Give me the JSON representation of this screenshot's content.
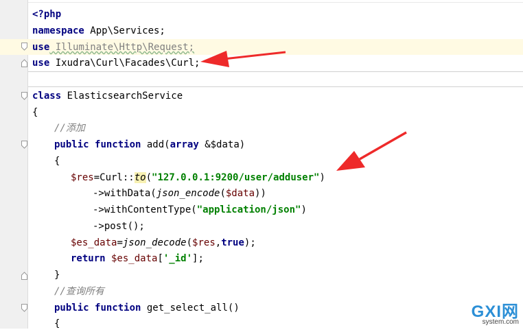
{
  "code": {
    "l1_tag": "<?php",
    "l2_kw": "namespace",
    "l2_rest": " App\\Services;",
    "l3_kw": "use",
    "l3_rest": " Illuminate\\Http\\Request;",
    "l4_kw": "use",
    "l4_rest": " Ixudra\\Curl\\Facades\\Curl;",
    "l5_kw": "class",
    "l5_rest": " ElasticsearchService",
    "l6": "{",
    "l7_comment": "//添加",
    "l8_kw1": "public",
    "l8_kw2": "function",
    "l8_name": " add(",
    "l8_kw3": "array",
    "l8_rest": " &$data)",
    "l9": "{",
    "l10_var": "$res",
    "l10_a": "=Curl::",
    "l10_to": "to",
    "l10_b": "(",
    "l10_str": "\"127.0.0.1:9200/user/adduser\"",
    "l10_c": ")",
    "l11_a": "->withData(",
    "l11_fn": "json_encode",
    "l11_b": "(",
    "l11_var": "$data",
    "l11_c": "))",
    "l12_a": "->withContentType(",
    "l12_str": "\"application/json\"",
    "l12_c": ")",
    "l13": "->post();",
    "l14_var": "$es_data",
    "l14_a": "=",
    "l14_fn": "json_decode",
    "l14_b": "(",
    "l14_var2": "$res",
    "l14_c": ",",
    "l14_kw": "true",
    "l14_d": ");",
    "l15_kw": "return",
    "l15_var": " $es_data",
    "l15_a": "[",
    "l15_str": "'_id'",
    "l15_b": "];",
    "l16": "}",
    "l17_comment": "//查询所有",
    "l18_kw1": "public",
    "l18_kw2": "function",
    "l18_rest": " get_select_all()",
    "l19": "{"
  },
  "watermark": {
    "logo": "GXI网",
    "site": "system.com"
  },
  "colors": {
    "keyword": "#000080",
    "string": "#008000",
    "variable": "#660000",
    "comment": "#808080",
    "arrow": "#ee2a2a"
  }
}
